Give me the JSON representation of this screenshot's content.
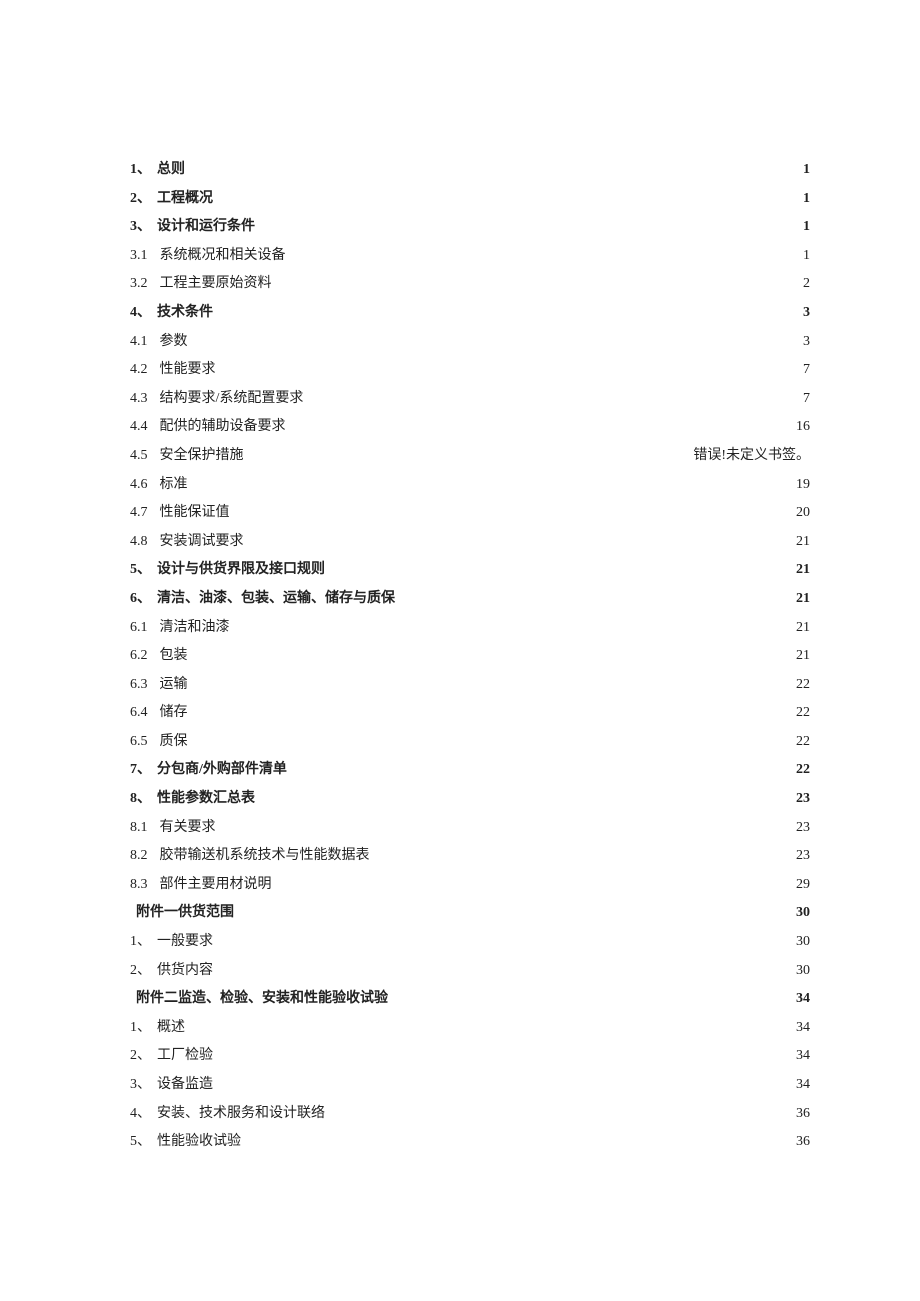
{
  "toc": [
    {
      "num": "1、",
      "title": "总则",
      "page": "1",
      "bold": true,
      "sub": false
    },
    {
      "num": "2、",
      "title": "工程概况",
      "page": "1",
      "bold": true,
      "sub": false
    },
    {
      "num": "3、",
      "title": "设计和运行条件",
      "page": "1",
      "bold": true,
      "sub": false
    },
    {
      "num": "3.1",
      "title": "系统概况和相关设备",
      "page": "1",
      "bold": false,
      "sub": true
    },
    {
      "num": "3.2",
      "title": "工程主要原始资料",
      "page": "2",
      "bold": false,
      "sub": true
    },
    {
      "num": "4、",
      "title": "技术条件",
      "page": "3",
      "bold": true,
      "sub": false
    },
    {
      "num": "4.1",
      "title": "参数",
      "page": "3",
      "bold": false,
      "sub": true
    },
    {
      "num": "4.2",
      "title": "性能要求",
      "page": "7",
      "bold": false,
      "sub": true
    },
    {
      "num": "4.3",
      "title": "结构要求/系统配置要求",
      "page": "7",
      "bold": false,
      "sub": true
    },
    {
      "num": "4.4",
      "title": "配供的辅助设备要求",
      "page": "16",
      "bold": false,
      "sub": true
    },
    {
      "num": "4.5",
      "title": "安全保护措施",
      "page": "错误!未定义书签。",
      "bold": false,
      "sub": true
    },
    {
      "num": "4.6",
      "title": "标准",
      "page": "19",
      "bold": false,
      "sub": true
    },
    {
      "num": "4.7",
      "title": "性能保证值",
      "page": "20",
      "bold": false,
      "sub": true
    },
    {
      "num": "4.8",
      "title": "安装调试要求",
      "page": "21",
      "bold": false,
      "sub": true
    },
    {
      "num": "5、",
      "title": "设计与供货界限及接口规则",
      "page": "21",
      "bold": true,
      "sub": false
    },
    {
      "num": "6、",
      "title": "清洁、油漆、包装、运输、储存与质保",
      "page": "21",
      "bold": true,
      "sub": false
    },
    {
      "num": "6.1",
      "title": "清洁和油漆",
      "page": "21",
      "bold": false,
      "sub": true
    },
    {
      "num": "6.2",
      "title": "包装",
      "page": "21",
      "bold": false,
      "sub": true
    },
    {
      "num": "6.3",
      "title": "运输",
      "page": "22",
      "bold": false,
      "sub": true
    },
    {
      "num": "6.4",
      "title": "储存",
      "page": "22",
      "bold": false,
      "sub": true
    },
    {
      "num": "6.5",
      "title": "质保",
      "page": "22",
      "bold": false,
      "sub": true
    },
    {
      "num": "7、",
      "title": "分包商/外购部件清单",
      "page": "22",
      "bold": true,
      "sub": false
    },
    {
      "num": "8、",
      "title": "性能参数汇总表",
      "page": "23",
      "bold": true,
      "sub": false
    },
    {
      "num": "8.1",
      "title": "有关要求",
      "page": "23",
      "bold": false,
      "sub": true
    },
    {
      "num": "8.2",
      "title": "胶带输送机系统技术与性能数据表",
      "page": "23",
      "bold": false,
      "sub": true
    },
    {
      "num": "8.3",
      "title": "部件主要用材说明",
      "page": "29",
      "bold": false,
      "sub": true
    },
    {
      "num": "",
      "title": "附件一供货范围",
      "page": "30",
      "bold": true,
      "sub": false
    },
    {
      "num": "1、",
      "title": "一般要求",
      "page": "30",
      "bold": false,
      "sub": false
    },
    {
      "num": "2、",
      "title": "供货内容",
      "page": "30",
      "bold": false,
      "sub": false
    },
    {
      "num": "",
      "title": "附件二监造、检验、安装和性能验收试验",
      "page": "34",
      "bold": true,
      "sub": false
    },
    {
      "num": "1、",
      "title": "概述",
      "page": "34",
      "bold": false,
      "sub": false
    },
    {
      "num": "2、",
      "title": "工厂检验",
      "page": "34",
      "bold": false,
      "sub": false
    },
    {
      "num": "3、",
      "title": "设备监造",
      "page": "34",
      "bold": false,
      "sub": false
    },
    {
      "num": "4、",
      "title": "安装、技术服务和设计联络",
      "page": "36",
      "bold": false,
      "sub": false
    },
    {
      "num": "5、",
      "title": "性能验收试验",
      "page": "36",
      "bold": false,
      "sub": false
    }
  ]
}
